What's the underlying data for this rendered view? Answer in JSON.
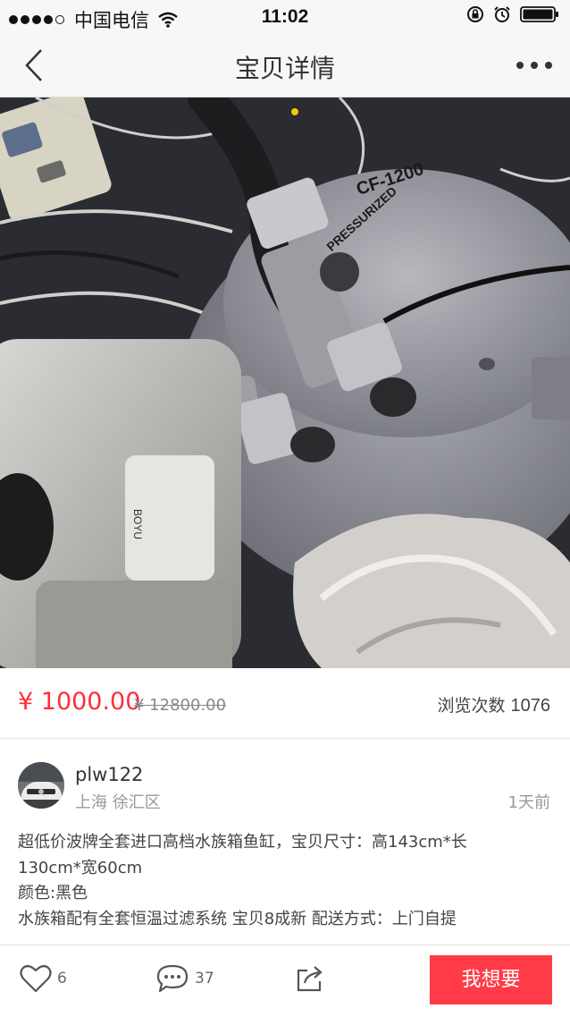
{
  "status_bar": {
    "carrier": "中国电信",
    "time": "11:02"
  },
  "nav": {
    "title": "宝贝详情",
    "back_icon": "chevron-left-icon",
    "more_icon": "more-dots-icon"
  },
  "gallery": {
    "image_labels": {
      "model": "CF-1200",
      "brand_lower": "BOYU",
      "side_text": "PRESSURIZED"
    }
  },
  "listing": {
    "price": "¥ 1000.00",
    "original_price": "¥ 12800.00",
    "views_label": "浏览次数",
    "views_count": "1076"
  },
  "seller": {
    "username": "plw122",
    "location": "上海 徐汇区",
    "posted": "1天前"
  },
  "description": {
    "lines": [
      "超低价波牌全套进口高档水族箱鱼缸，宝贝尺寸：高143cm*长",
      "130cm*宽60cm",
      "颜色:黑色",
      "水族箱配有全套恒温过滤系统 宝贝8成新 配送方式：上门自提"
    ]
  },
  "actions": {
    "likes": "6",
    "comments": "37",
    "want_label": "我想要"
  },
  "colors": {
    "accent": "#ff3b47",
    "price": "#ff2d3b"
  }
}
